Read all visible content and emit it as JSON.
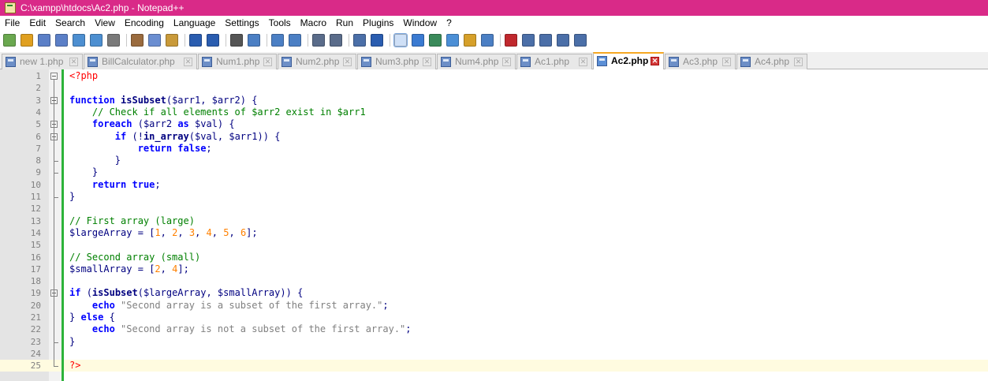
{
  "window": {
    "title": "C:\\xampp\\htdocs\\Ac2.php - Notepad++",
    "title_color": "#d92a88"
  },
  "menu": [
    "File",
    "Edit",
    "Search",
    "View",
    "Encoding",
    "Language",
    "Settings",
    "Tools",
    "Macro",
    "Run",
    "Plugins",
    "Window",
    "?"
  ],
  "toolbar_icons": [
    "new-file-icon",
    "open-file-icon",
    "save-icon",
    "save-all-icon",
    "close-icon",
    "close-all-icon",
    "print-icon",
    "cut-icon",
    "copy-icon",
    "paste-icon",
    "undo-icon",
    "redo-icon",
    "find-icon",
    "replace-icon",
    "zoom-in-icon",
    "zoom-out-icon",
    "sync-vertical-icon",
    "sync-horizontal-icon",
    "word-wrap-icon",
    "show-all-chars-icon",
    "indent-guide-icon",
    "language-icon",
    "doc-map-icon",
    "function-list-icon",
    "folder-workspace-icon",
    "monitor-icon",
    "record-macro-icon",
    "stop-record-icon",
    "playback-icon",
    "run-macro-multiple-icon",
    "save-macro-icon"
  ],
  "tabs": [
    {
      "label": "new 1.php",
      "active": false
    },
    {
      "label": "BillCalculator.php",
      "active": false
    },
    {
      "label": "Num1.php",
      "active": false
    },
    {
      "label": "Num2.php",
      "active": false
    },
    {
      "label": "Num3.php",
      "active": false
    },
    {
      "label": "Num4.php",
      "active": false
    },
    {
      "label": "Ac1.php",
      "active": false
    },
    {
      "label": "Ac2.php",
      "active": true
    },
    {
      "label": "Ac3.php",
      "active": false
    },
    {
      "label": "Ac4.php",
      "active": false
    }
  ],
  "editor": {
    "lines": [
      "<?php",
      "",
      "function isSubset($arr1, $arr2) {",
      "    // Check if all elements of $arr2 exist in $arr1",
      "    foreach ($arr2 as $val) {",
      "        if (!in_array($val, $arr1)) {",
      "            return false;",
      "        }",
      "    }",
      "    return true;",
      "}",
      "",
      "// First array (large)",
      "$largeArray = [1, 2, 3, 4, 5, 6];",
      "",
      "// Second array (small)",
      "$smallArray = [2, 4];",
      "",
      "if (isSubset($largeArray, $smallArray)) {",
      "    echo \"Second array is a subset of the first array.\";",
      "} else {",
      "    echo \"Second array is not a subset of the first array.\";",
      "}",
      "",
      "?>"
    ],
    "line_numbers": [
      "1",
      "2",
      "3",
      "4",
      "5",
      "6",
      "7",
      "8",
      "9",
      "10",
      "11",
      "12",
      "13",
      "14",
      "15",
      "16",
      "17",
      "18",
      "19",
      "20",
      "21",
      "22",
      "23",
      "24",
      "25"
    ],
    "current_line": 25,
    "change_bar_color": "#2db33a"
  }
}
